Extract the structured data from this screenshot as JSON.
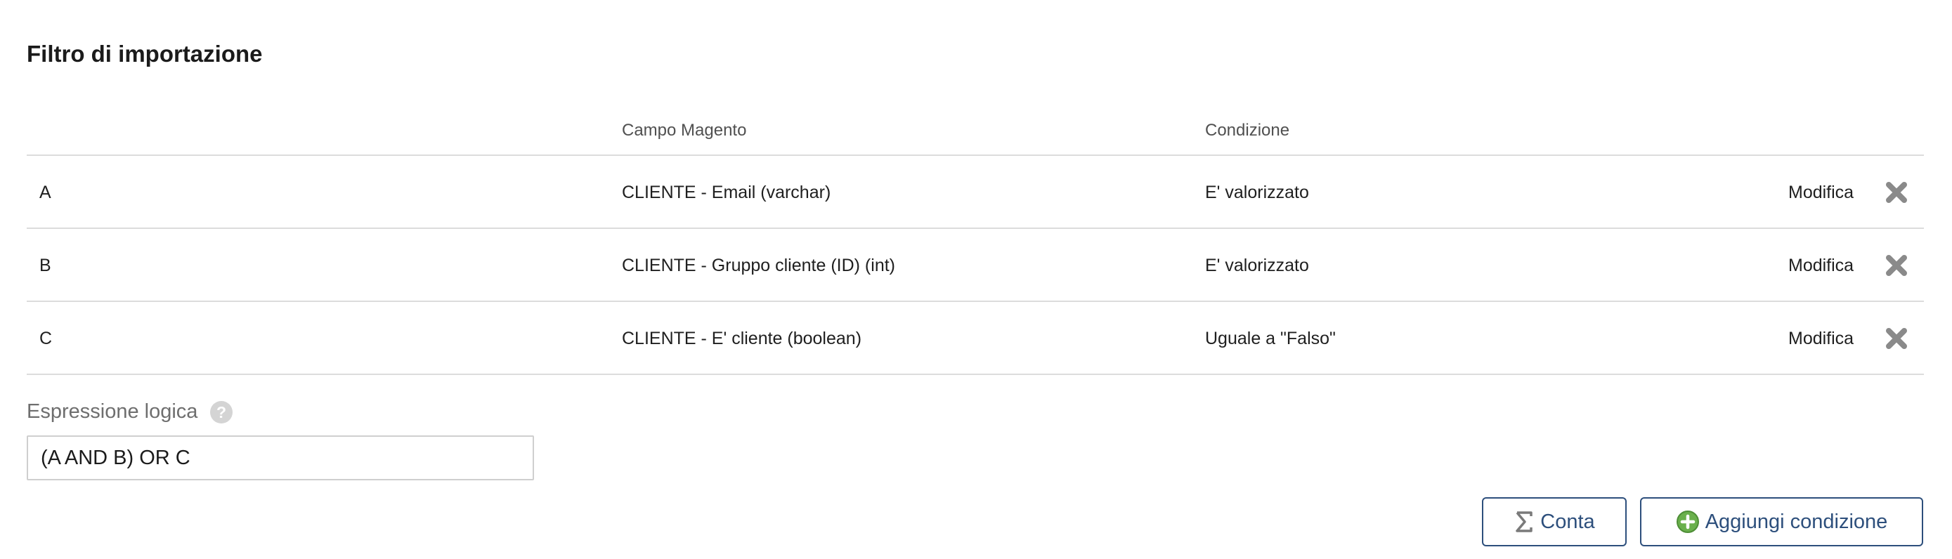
{
  "section": {
    "title": "Filtro di importazione"
  },
  "table": {
    "headers": {
      "field": "Campo Magento",
      "condition": "Condizione"
    },
    "rows": [
      {
        "letter": "A",
        "field": "CLIENTE - Email (varchar)",
        "condition": "E' valorizzato",
        "edit_label": "Modifica"
      },
      {
        "letter": "B",
        "field": "CLIENTE - Gruppo cliente (ID) (int)",
        "condition": "E' valorizzato",
        "edit_label": "Modifica"
      },
      {
        "letter": "C",
        "field": "CLIENTE - E' cliente (boolean)",
        "condition": "Uguale a \"Falso\"",
        "edit_label": "Modifica"
      }
    ]
  },
  "expression": {
    "label": "Espressione logica",
    "value": "(A AND B) OR C"
  },
  "buttons": {
    "count_label": "Conta",
    "add_label": "Aggiungi condizione"
  },
  "colors": {
    "accent": "#2d4f7c",
    "add_icon_green": "#6ab04c",
    "delete_icon": "#8a8a8a"
  },
  "icons": {
    "delete": "close-x-icon",
    "help": "question-mark-icon",
    "count": "sigma-icon",
    "add": "plus-circle-icon"
  }
}
